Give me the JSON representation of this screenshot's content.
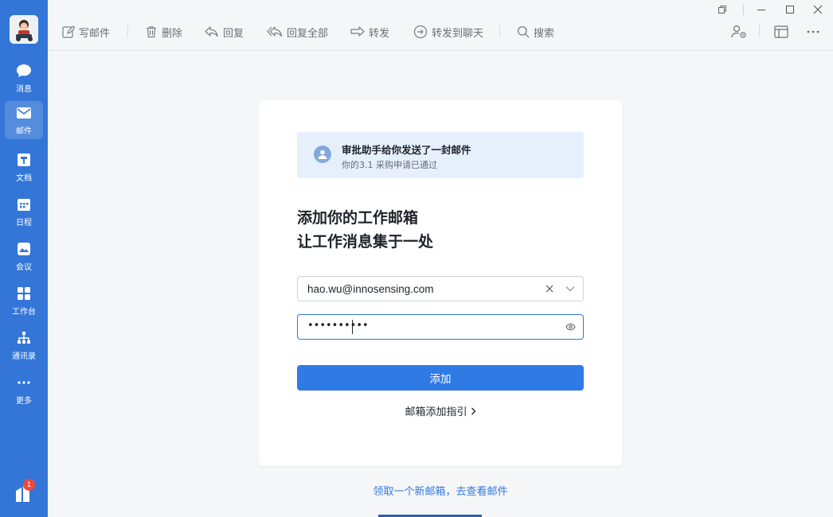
{
  "sidebar": {
    "items": [
      {
        "label": "消息",
        "icon": "message-icon"
      },
      {
        "label": "邮件",
        "icon": "mail-icon"
      },
      {
        "label": "文档",
        "icon": "document-icon"
      },
      {
        "label": "日程",
        "icon": "calendar-icon"
      },
      {
        "label": "会议",
        "icon": "meeting-icon"
      },
      {
        "label": "工作台",
        "icon": "workplace-icon"
      },
      {
        "label": "通讯录",
        "icon": "contacts-icon"
      },
      {
        "label": "更多",
        "icon": "more-icon"
      }
    ],
    "notification_count": "1"
  },
  "toolbar": {
    "compose": "写邮件",
    "delete": "删除",
    "reply": "回复",
    "reply_all": "回复全部",
    "forward": "转发",
    "forward_chat": "转发到聊天",
    "search": "搜索"
  },
  "banner": {
    "title": "审批助手给你发送了一封邮件",
    "subtitle": "你的3.1 采购申请已通过"
  },
  "heading": {
    "line1": "添加你的工作邮箱",
    "line2": "让工作消息集于一处"
  },
  "form": {
    "email_value": "hao.wu@innosensing.com",
    "password_mask": "••••••••••",
    "add_button": "添加",
    "guide_link": "邮箱添加指引"
  },
  "footer_link": "领取一个新邮箱，去查看邮件",
  "colors": {
    "sidebar": "#3476d8",
    "primary": "#2f7ae5",
    "banner_bg": "#e6f0fd",
    "badge": "#f0483b"
  }
}
